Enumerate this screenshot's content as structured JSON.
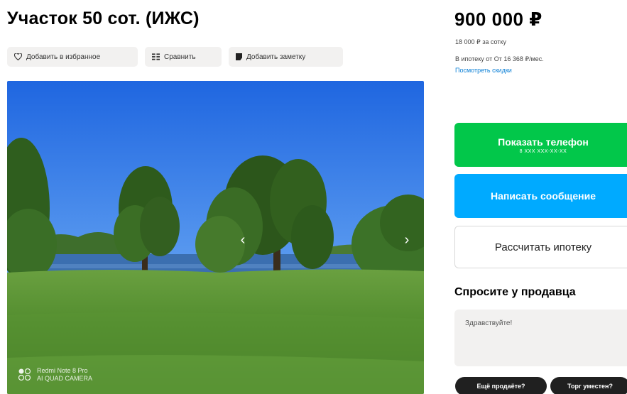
{
  "listing": {
    "title": "Участок 50 сот. (ИЖС)",
    "actions": {
      "favorite": "Добавить в избранное",
      "compare": "Сравнить",
      "note": "Добавить заметку"
    },
    "photo": {
      "watermark_line1": "Redmi Note 8 Pro",
      "watermark_line2": "AI QUAD CAMERA"
    }
  },
  "sidebar": {
    "price": "900 000 ₽",
    "price_per_unit": "18 000 ₽ за сотку",
    "mortgage": "В ипотеку от От 16 368 ₽/мес.",
    "discounts_link": "Посмотреть скидки",
    "show_phone": "Показать телефон",
    "phone_mask": "8 XXX XXX-XX-XX",
    "write_message": "Написать сообщение",
    "calc_mortgage": "Рассчитать ипотеку",
    "ask_seller": {
      "title": "Спросите у продавца",
      "placeholder": "Здравствуйте!",
      "chips": [
        "Ещё продаёте?",
        "Торг уместен?"
      ]
    }
  },
  "colors": {
    "green": "#02c74a",
    "blue": "#00aaff",
    "link": "#0a7fd6",
    "chip": "#202020"
  }
}
